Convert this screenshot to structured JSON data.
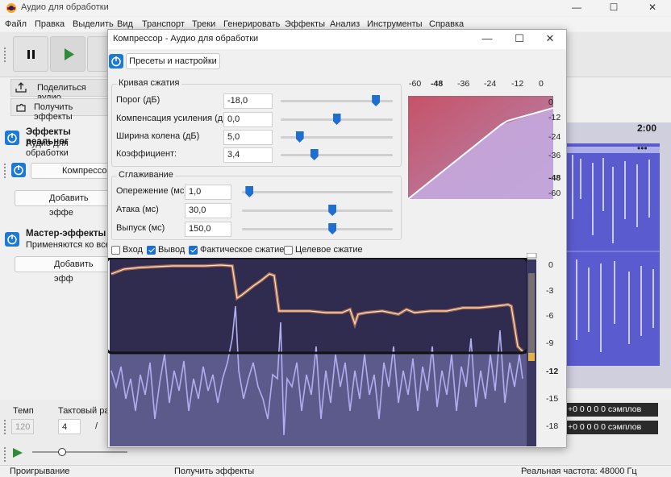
{
  "app": {
    "title": "Аудио для обработки",
    "menu": [
      "Файл",
      "Правка",
      "Выделить",
      "Вид",
      "Транспорт",
      "Треки",
      "Генерировать",
      "Эффекты",
      "Анализ",
      "Инструменты",
      "Справка"
    ]
  },
  "left": {
    "share_label": "Поделиться аудио",
    "get_effects_label": "Получить эффекты",
    "realtime_title": "Эффекты реальног",
    "realtime_subtitle": "Аудио для обработки",
    "effect_slot": "Компрессор",
    "add_effect": "Добавить эффе",
    "master_title": "Мастер-эффекты",
    "master_subtitle": "Применяются ко все",
    "add_effect_master": "Добавить эфф"
  },
  "bottom": {
    "tempo_label": "Темп",
    "tempo_value": "120",
    "meter_label": "Тактовый ра",
    "meter_value": "4",
    "meter_sep": "/",
    "sel_time_1": "+0 0 0 0 0 сэмплов",
    "sel_time_2": "+0 0 0 0 0 сэмплов"
  },
  "timeline": {
    "tick": "2:00"
  },
  "status": {
    "left": "Проигрывание",
    "middle": "Получить эффекты",
    "right": "Реальная частота: 48000 Гц"
  },
  "dialog": {
    "title": "Компрессор - Аудио для обработки",
    "presets_label": "Пресеты и настройки",
    "curve_group": "Кривая сжатия",
    "smooth_group": "Сглаживание",
    "params": [
      {
        "label": "Порог (дБ)",
        "value": "-18,0",
        "level": 0.85
      },
      {
        "label": "Компенсация усиления (дБ)",
        "value": "0,0",
        "level": 0.5
      },
      {
        "label": "Ширина колена (дБ)",
        "value": "5,0",
        "level": 0.17
      },
      {
        "label": "Коэффициент:",
        "value": "3,4",
        "level": 0.3
      }
    ],
    "smoothing": [
      {
        "label": "Опережение (мс)",
        "value": "1,0",
        "level": 0.05
      },
      {
        "label": "Атака (мс)",
        "value": "30,0",
        "level": 0.6
      },
      {
        "label": "Выпуск (мс)",
        "value": "150,0",
        "level": 0.6
      }
    ],
    "curve_x_ticks": [
      "-60",
      "-48",
      "-36",
      "-24",
      "-12",
      "0"
    ],
    "curve_y_ticks": [
      "0",
      "-12",
      "-24",
      "-36",
      "-48",
      "-60"
    ],
    "checkboxes": [
      {
        "label": "Вход",
        "checked": false
      },
      {
        "label": "Вывод",
        "checked": true
      },
      {
        "label": "Фактическое сжатие",
        "checked": true
      },
      {
        "label": "Целевое сжатие",
        "checked": false
      }
    ],
    "meter_ticks": [
      "0",
      "-3",
      "-6",
      "-9",
      "-12",
      "-15",
      "-18"
    ]
  },
  "colors": {
    "accent": "#1c6fd1",
    "graph_bg": "#3a3858",
    "curve_red": "#c85a6a",
    "curve_purple": "#b59ad0"
  }
}
